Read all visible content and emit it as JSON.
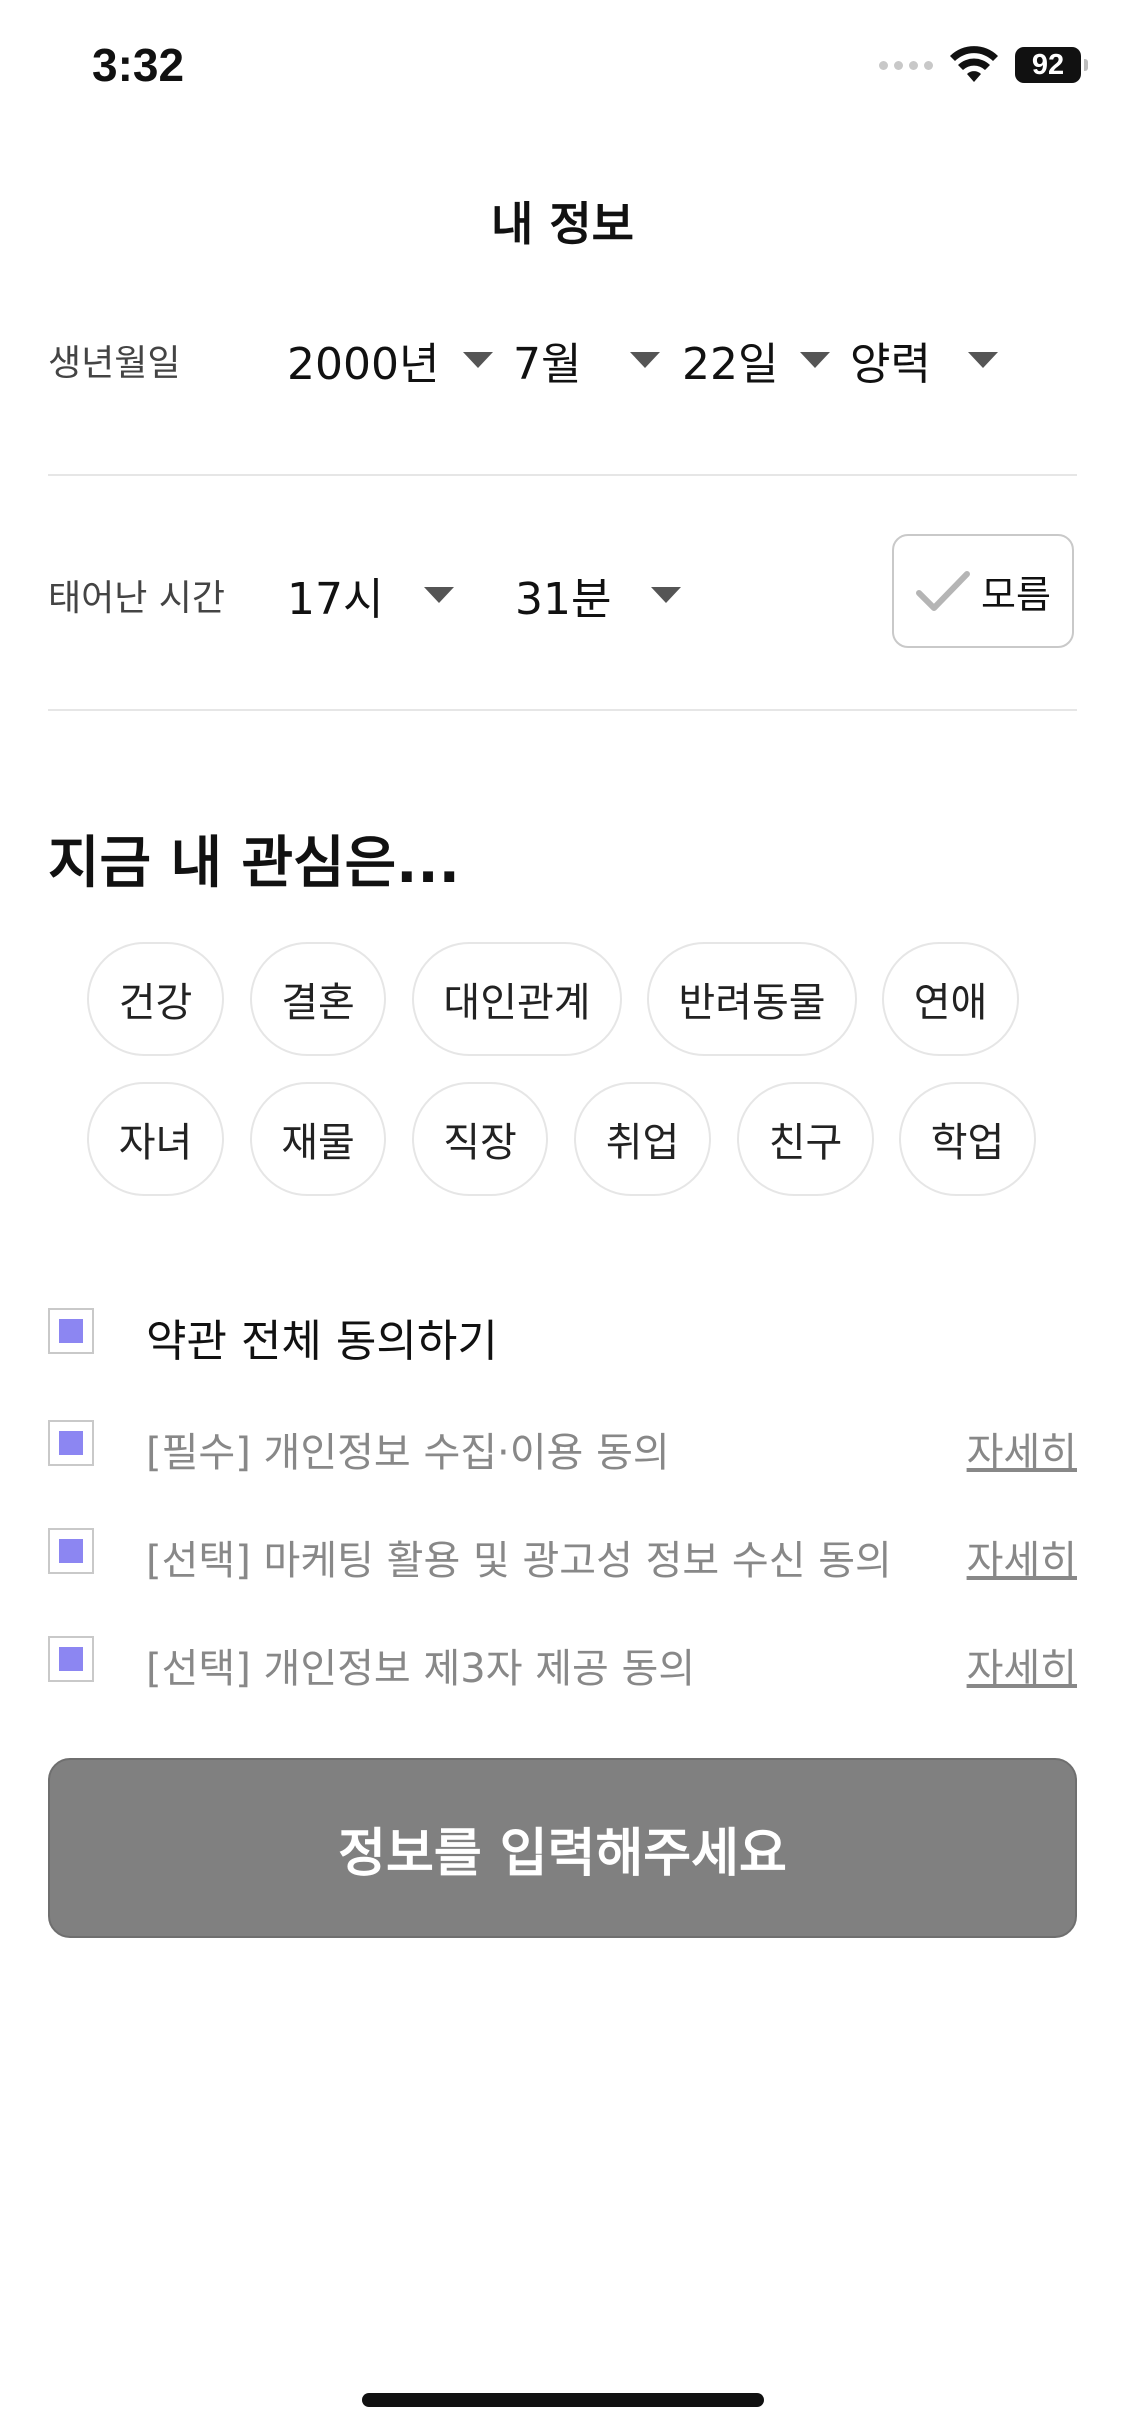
{
  "status_bar": {
    "time": "3:32",
    "battery": "92"
  },
  "header": {
    "title": "내 정보"
  },
  "birth": {
    "label": "생년월일",
    "year": "2000년",
    "month": "7월",
    "day": "22일",
    "calendar": "양력"
  },
  "birth_time": {
    "label": "태어난 시간",
    "hour": "17시",
    "minute": "31분",
    "unknown_label": "모름"
  },
  "interests": {
    "title": "지금 내 관심은...",
    "chips": [
      "건강",
      "결혼",
      "대인관계",
      "반려동물",
      "연애",
      "자녀",
      "재물",
      "직장",
      "취업",
      "친구",
      "학업"
    ]
  },
  "agreements": {
    "all": "약관 전체 동의하기",
    "items": [
      {
        "text": "[필수] 개인정보 수집·이용 동의",
        "detail": "자세히"
      },
      {
        "text": "[선택] 마케팅 활용 및 광고성 정보 수신 동의",
        "detail": "자세히"
      },
      {
        "text": "[선택] 개인정보 제3자 제공 동의",
        "detail": "자세히"
      }
    ]
  },
  "submit": {
    "label": "정보를 입력해주세요"
  },
  "colors": {
    "checkbox_fill": "#8c86f2",
    "submit_bg": "#808080"
  }
}
